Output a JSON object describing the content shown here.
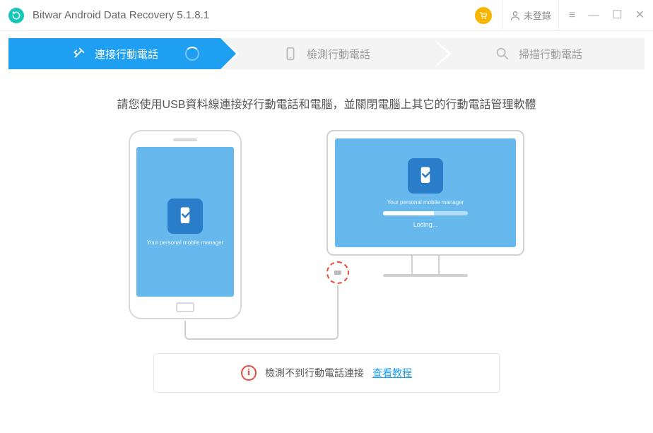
{
  "titlebar": {
    "app_name": "Bitwar Android Data Recovery  5.1.8.1",
    "login_label": "未登錄"
  },
  "steps": {
    "step1": "連接行動電話",
    "step2": "檢測行動電話",
    "step3": "掃描行動電話"
  },
  "instruction": "請您使用USB資料線連接好行動電話和電腦，並關閉電腦上其它的行動電話管理軟體",
  "phone": {
    "label": "Your personal mobile manager"
  },
  "monitor": {
    "label": "Your personal mobile manager",
    "loading": "Loding..."
  },
  "info": {
    "message": "檢測不到行動電話連接",
    "link": "查看教程"
  }
}
